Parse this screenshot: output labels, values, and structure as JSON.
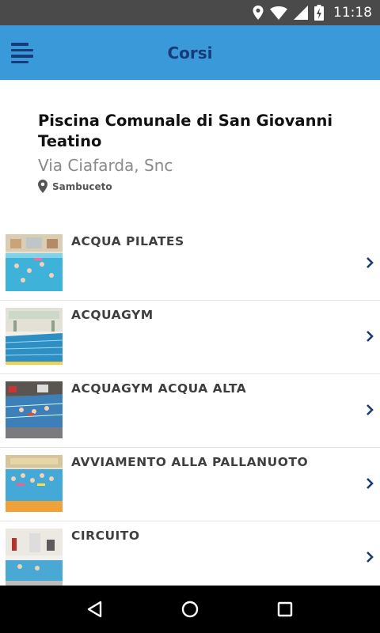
{
  "status_bar": {
    "time": "11:18",
    "icons": [
      "location-icon",
      "wifi-icon",
      "signal-icon",
      "battery-charging-icon"
    ]
  },
  "app_bar": {
    "title": "Corsi",
    "menu_icon": "menu-icon"
  },
  "venue": {
    "name": "Piscina Comunale di San Giovanni Teatino",
    "street": "Via Ciafarda, Snc",
    "city": "Sambuceto",
    "city_icon": "location-pin-icon"
  },
  "courses": [
    {
      "title": "ACQUA PILATES",
      "thumbnail": "pool-photo",
      "chevron": "chevron-right-icon"
    },
    {
      "title": "ACQUAGYM",
      "thumbnail": "pool-photo",
      "chevron": "chevron-right-icon"
    },
    {
      "title": "ACQUAGYM ACQUA ALTA",
      "thumbnail": "pool-photo",
      "chevron": "chevron-right-icon"
    },
    {
      "title": "AVVIAMENTO ALLA PALLANUOTO",
      "thumbnail": "pool-photo",
      "chevron": "chevron-right-icon"
    },
    {
      "title": "CIRCUITO",
      "thumbnail": "pool-photo",
      "chevron": "chevron-right-icon"
    }
  ],
  "nav_bar": {
    "buttons": [
      "back-icon",
      "home-icon",
      "recents-icon"
    ]
  },
  "colors": {
    "app_bar": "#3a9ad9",
    "app_title": "#173a78",
    "status_bar": "#4a4a4a",
    "chevron": "#173a78"
  }
}
